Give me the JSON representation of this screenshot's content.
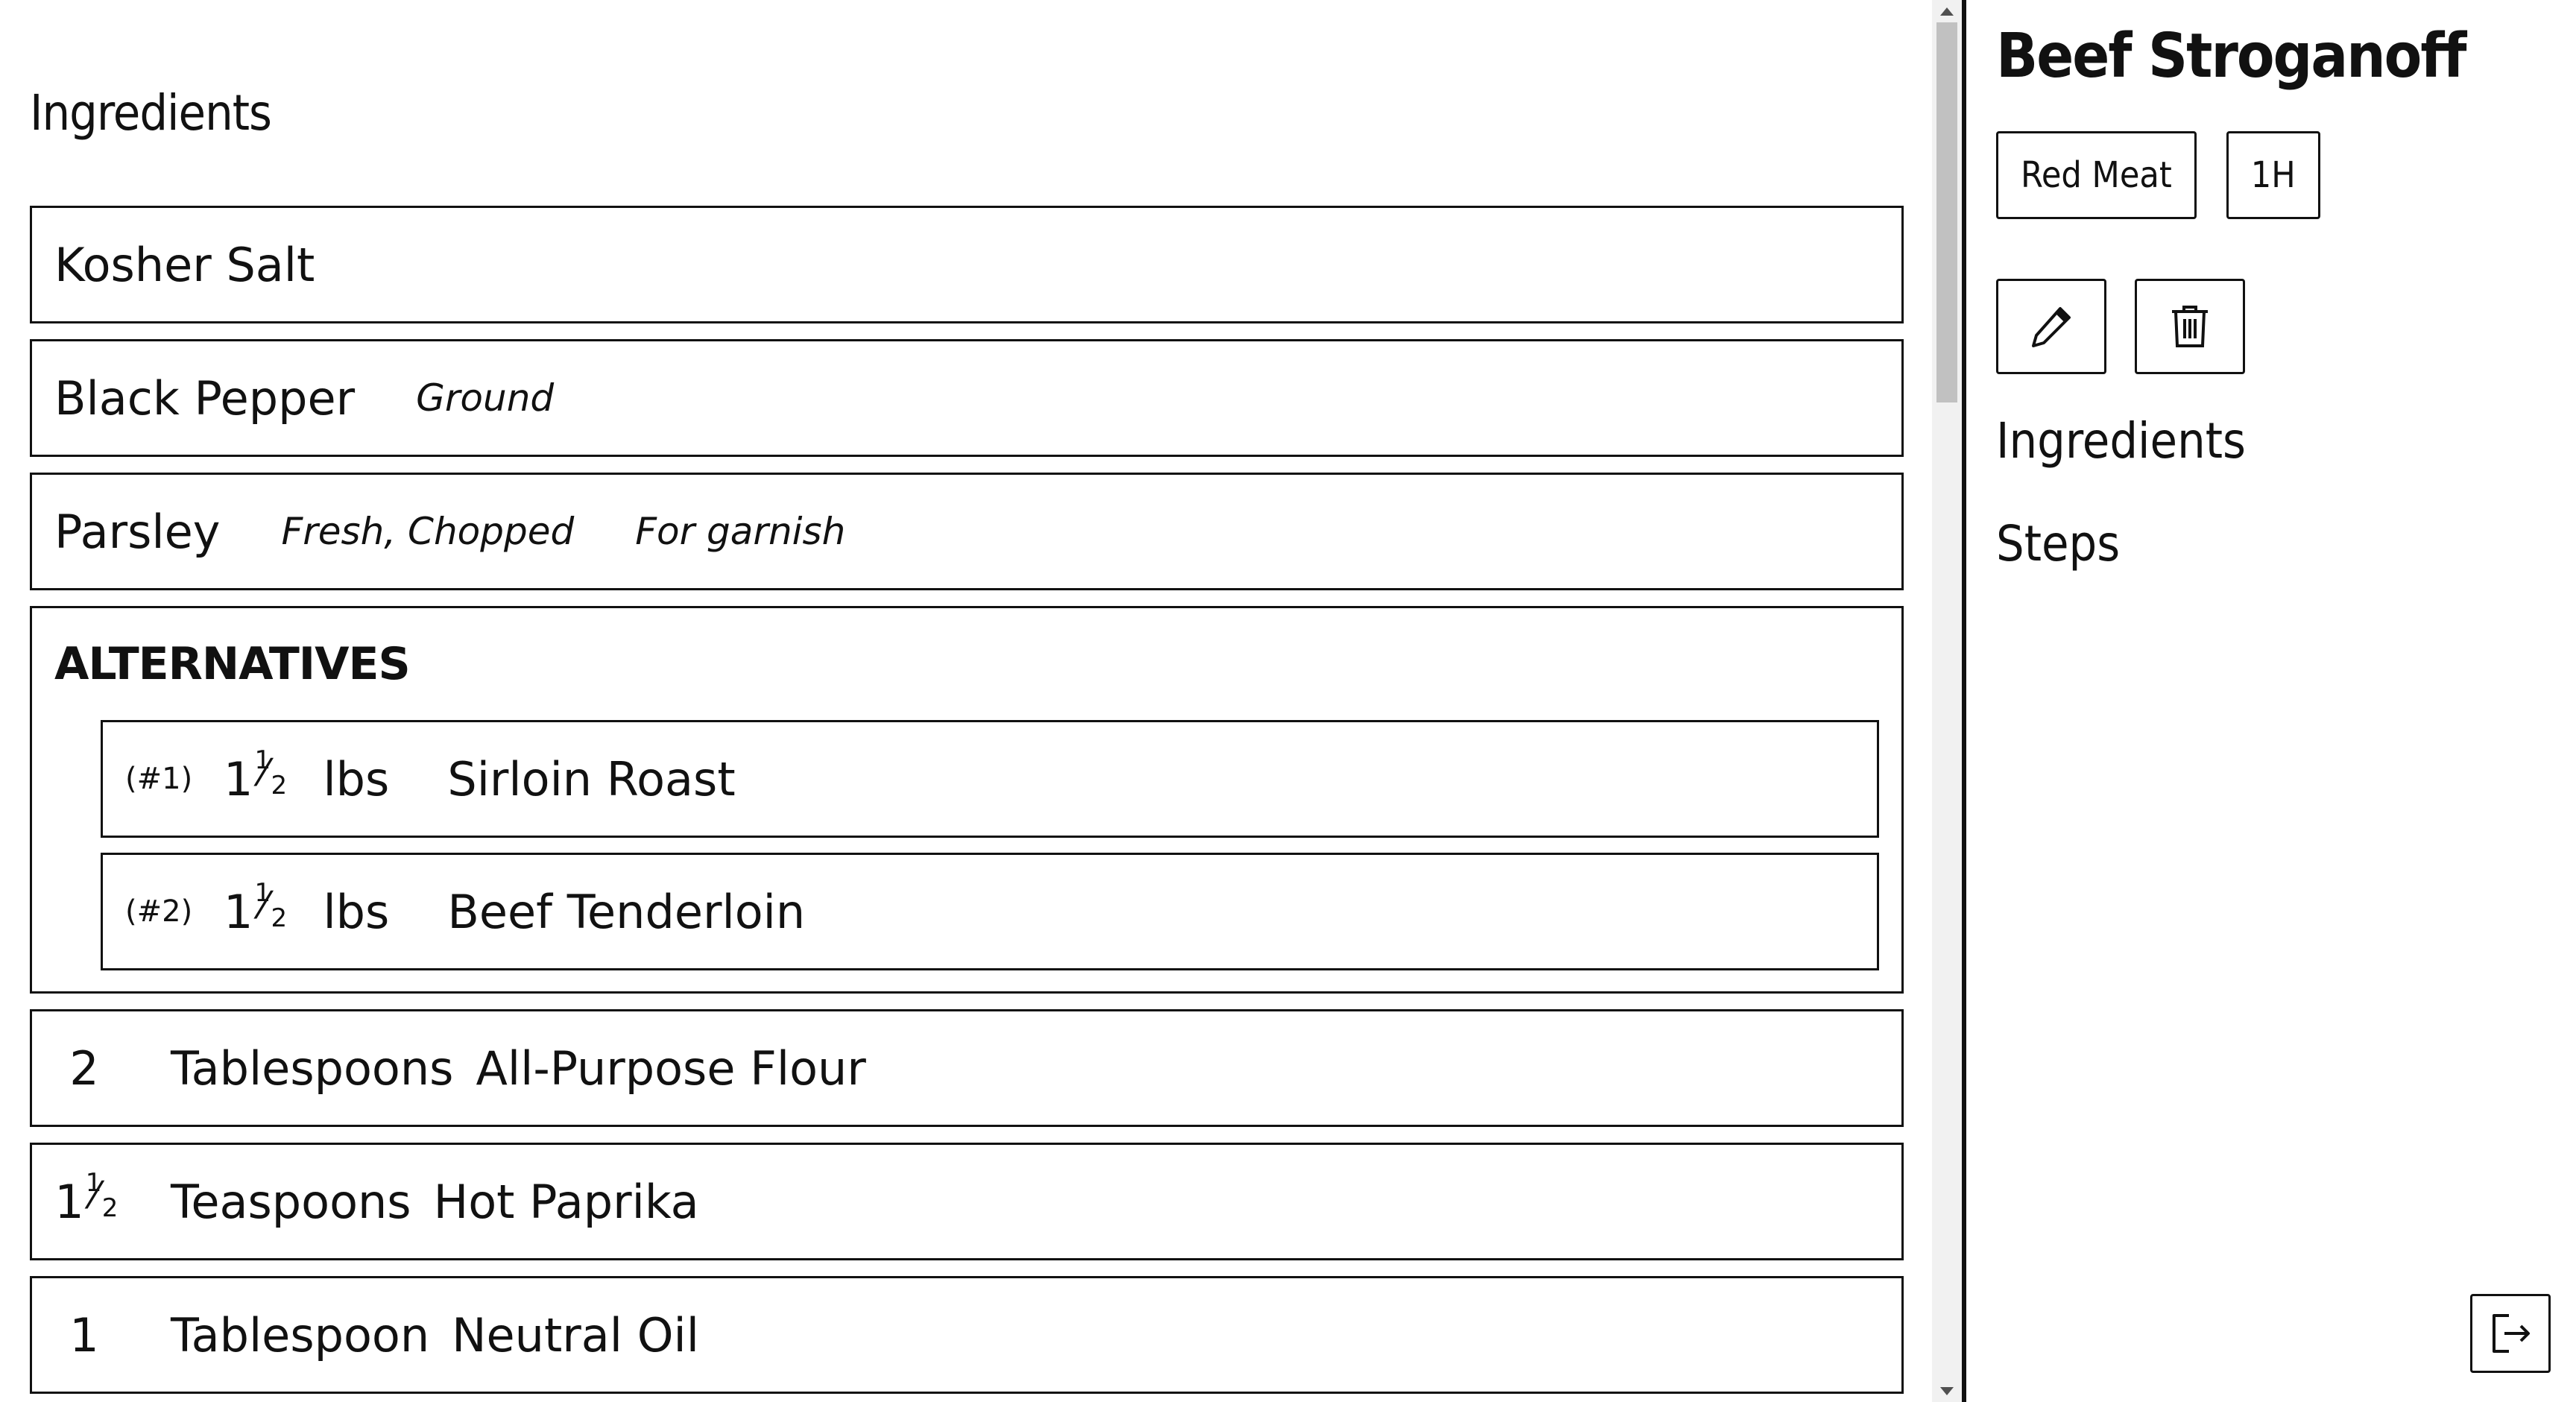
{
  "main": {
    "section_title": "Ingredients",
    "ingredients": [
      {
        "name": "Kosher Salt",
        "notes": []
      },
      {
        "name": "Black Pepper",
        "notes": [
          "Ground"
        ]
      },
      {
        "name": "Parsley",
        "notes": [
          "Fresh, Chopped",
          "For garnish"
        ]
      }
    ],
    "alternatives": {
      "title": "ALTERNATIVES",
      "items": [
        {
          "index": "(#1)",
          "qty_whole": "1",
          "qty_num": "1",
          "qty_den": "2",
          "unit": "lbs",
          "name": "Sirloin Roast"
        },
        {
          "index": "(#2)",
          "qty_whole": "1",
          "qty_num": "1",
          "qty_den": "2",
          "unit": "lbs",
          "name": "Beef Tenderloin"
        }
      ]
    },
    "measured": [
      {
        "qty_whole": "2",
        "unit": "Tablespoons",
        "name": "All-Purpose Flour"
      },
      {
        "qty_whole": "1",
        "qty_num": "1",
        "qty_den": "2",
        "unit": "Teaspoons",
        "name": "Hot Paprika"
      },
      {
        "qty_whole": "1",
        "unit": "Tablespoon",
        "name": "Neutral Oil"
      }
    ]
  },
  "sidebar": {
    "recipe_title": "Beef Stroganoff",
    "tags": [
      "Red Meat",
      "1H"
    ],
    "nav": {
      "ingredients": "Ingredients",
      "steps": "Steps"
    },
    "icons": {
      "edit": "pencil-icon",
      "delete": "trash-icon",
      "logout": "logout-icon"
    }
  }
}
